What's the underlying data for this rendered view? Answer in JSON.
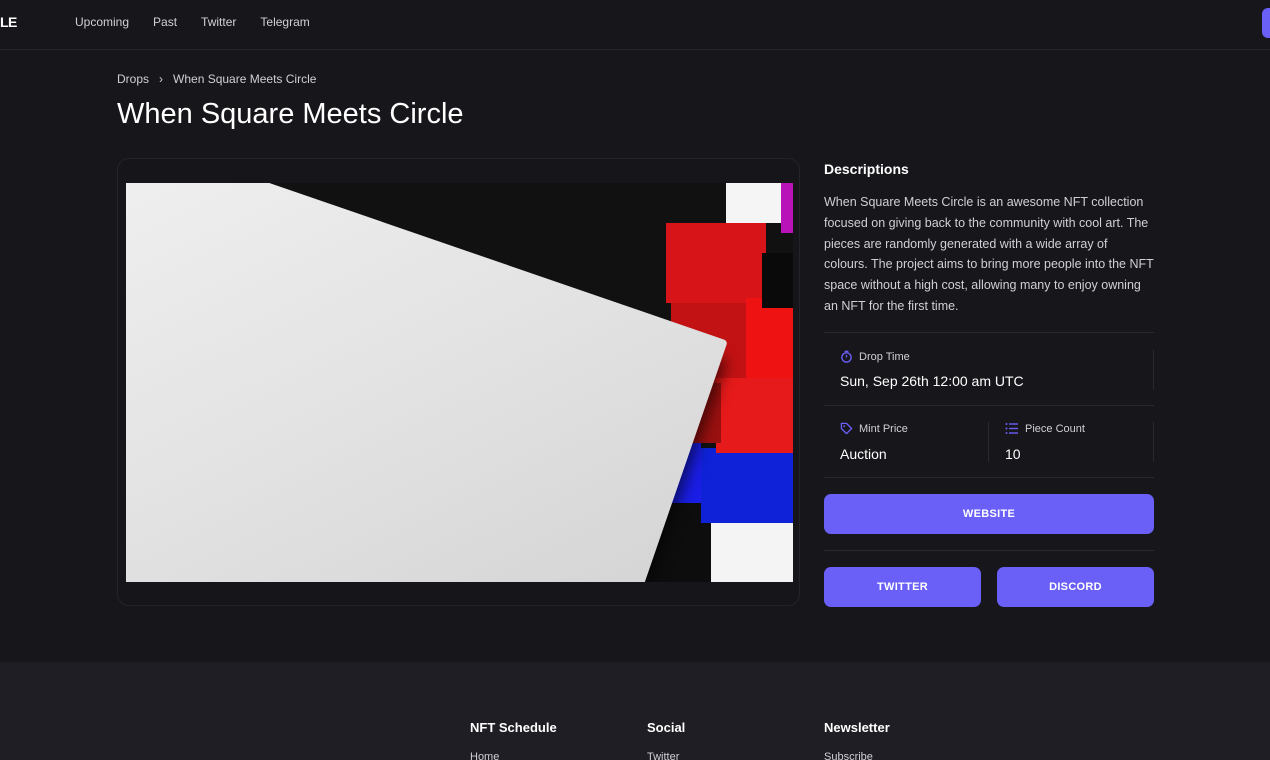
{
  "header": {
    "logo_fragment": "LE",
    "nav": [
      {
        "label": "Upcoming"
      },
      {
        "label": "Past"
      },
      {
        "label": "Twitter"
      },
      {
        "label": "Telegram"
      }
    ]
  },
  "breadcrumb": {
    "root": "Drops",
    "separator": "›",
    "current": "When Square Meets Circle"
  },
  "page_title": "When Square Meets Circle",
  "artwork": {
    "alt": "When Square Meets Circle artwork"
  },
  "descriptions": {
    "title": "Descriptions",
    "text": "When Square Meets Circle is an awesome NFT collection focused on giving back to the community with cool art. The pieces are randomly generated with a wide array of colours. The project aims to bring more people into the NFT space without a high cost, allowing many to enjoy owning an NFT for the first time."
  },
  "details": {
    "drop_time": {
      "label": "Drop Time",
      "value": "Sun, Sep 26th 12:00 am UTC",
      "icon": "stopwatch-icon"
    },
    "mint_price": {
      "label": "Mint Price",
      "value": "Auction",
      "icon": "tag-icon"
    },
    "piece_count": {
      "label": "Piece Count",
      "value": "10",
      "icon": "list-icon"
    }
  },
  "buttons": {
    "website": "WEBSITE",
    "twitter": "TWITTER",
    "discord": "DISCORD"
  },
  "footer": {
    "columns": [
      {
        "title": "NFT Schedule",
        "first_link": "Home"
      },
      {
        "title": "Social",
        "first_link": "Twitter"
      },
      {
        "title": "Newsletter",
        "first_link": "Subscribe"
      }
    ]
  },
  "colors": {
    "background": "#17161b",
    "accent": "#6a5ff7",
    "footer": "#1f1e24"
  }
}
